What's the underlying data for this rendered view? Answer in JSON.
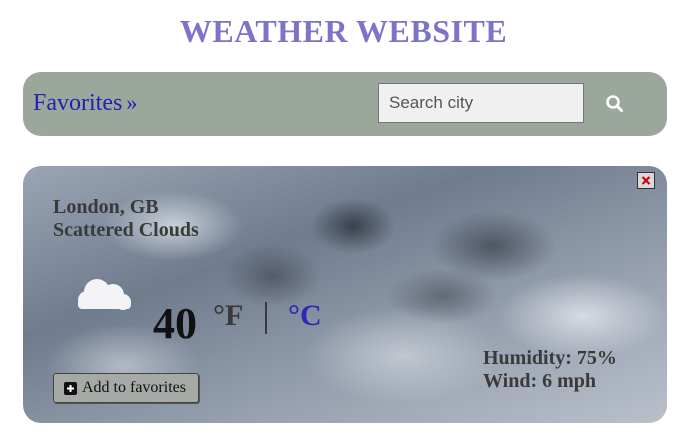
{
  "header": {
    "title": "WEATHER WEBSITE"
  },
  "topbar": {
    "favorites_label": "Favorites",
    "favorites_icon": "double-chevron-right-icon",
    "search": {
      "placeholder": "Search city",
      "value": ""
    },
    "search_icon": "search-icon"
  },
  "weather": {
    "location": "London, GB",
    "condition": "Scattered Clouds",
    "condition_icon": "cloud-icon",
    "temperature": "40",
    "unit_f": "°F",
    "unit_c": "°C",
    "humidity": "Humidity: 75%",
    "wind": "Wind: 6 mph",
    "add_favorites_label": "Add to favorites",
    "close_icon": "close-icon"
  },
  "colors": {
    "title": "#7b74c7",
    "topbar_bg": "#9aa79a",
    "link": "#2121b8",
    "active_unit": "#2a2ab8",
    "close_x": "#cc0000"
  }
}
